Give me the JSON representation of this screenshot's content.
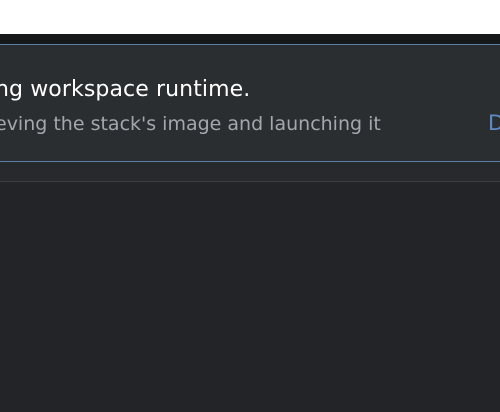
{
  "notification": {
    "title": "ng workspace runtime.",
    "subtitle": "eving the stack's image and launching it",
    "action_label": "D"
  },
  "colors": {
    "background": "#222427",
    "panel": "#2b2e31",
    "border_accent": "#5c7ea6",
    "action": "#5f8bc4",
    "title_text": "#ffffff",
    "subtitle_text": "#a4a8ad"
  }
}
